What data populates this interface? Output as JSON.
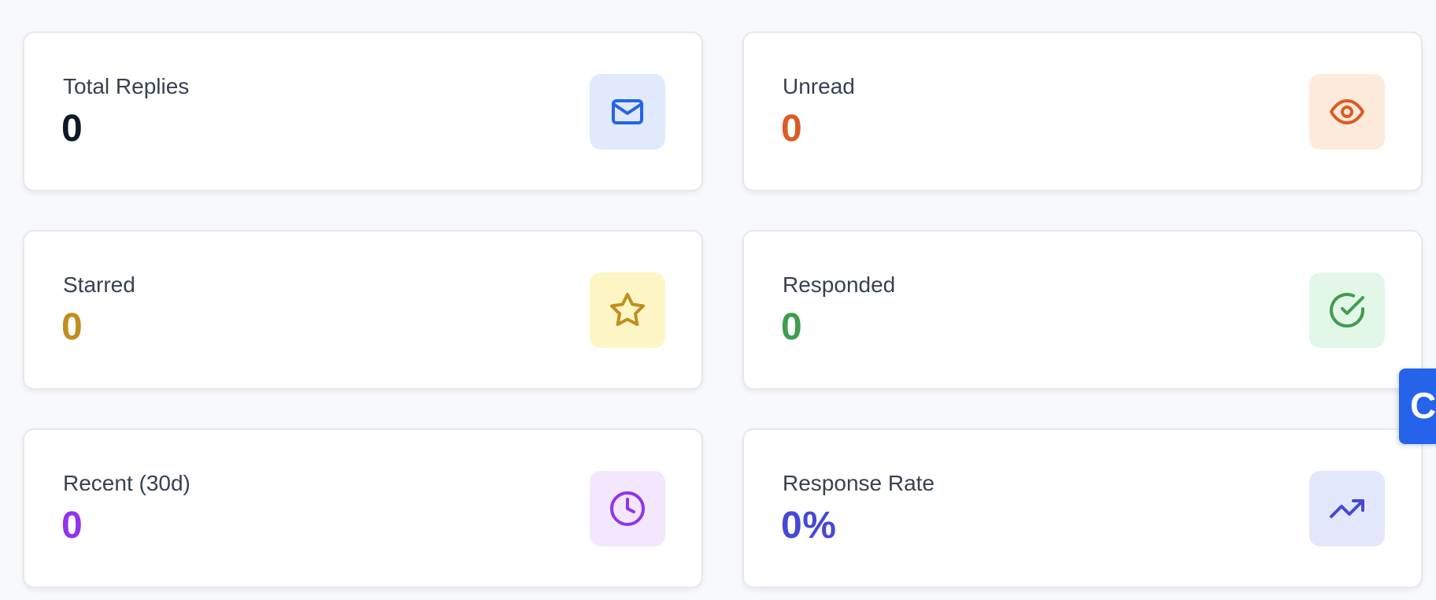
{
  "stats": [
    {
      "label": "Total Replies",
      "value": "0",
      "icon": "mail-icon",
      "color": "#111827",
      "icon_color": "#2563eb",
      "icon_bg": "#e0eafc"
    },
    {
      "label": "Unread",
      "value": "0",
      "icon": "eye-icon",
      "color": "#dd5a24",
      "icon_color": "#dd5a24",
      "icon_bg": "#fcebdb"
    },
    {
      "label": "Starred",
      "value": "0",
      "icon": "star-icon",
      "color": "#c28d1f",
      "icon_color": "#c28d1f",
      "icon_bg": "#fdf6c4"
    },
    {
      "label": "Responded",
      "value": "0",
      "icon": "check-circle-icon",
      "color": "#3f9d4f",
      "icon_color": "#3f9d4f",
      "icon_bg": "#e3f7e8"
    },
    {
      "label": "Recent (30d)",
      "value": "0",
      "icon": "clock-icon",
      "color": "#9333ea",
      "icon_color": "#9333ea",
      "icon_bg": "#f2e7fc"
    },
    {
      "label": "Response Rate",
      "value": "0%",
      "icon": "trending-up-icon",
      "color": "#4648d4",
      "icon_color": "#4648d4",
      "icon_bg": "#e3e7fb"
    }
  ],
  "side_tab": {
    "glyph": "C",
    "color": "#2563eb"
  }
}
